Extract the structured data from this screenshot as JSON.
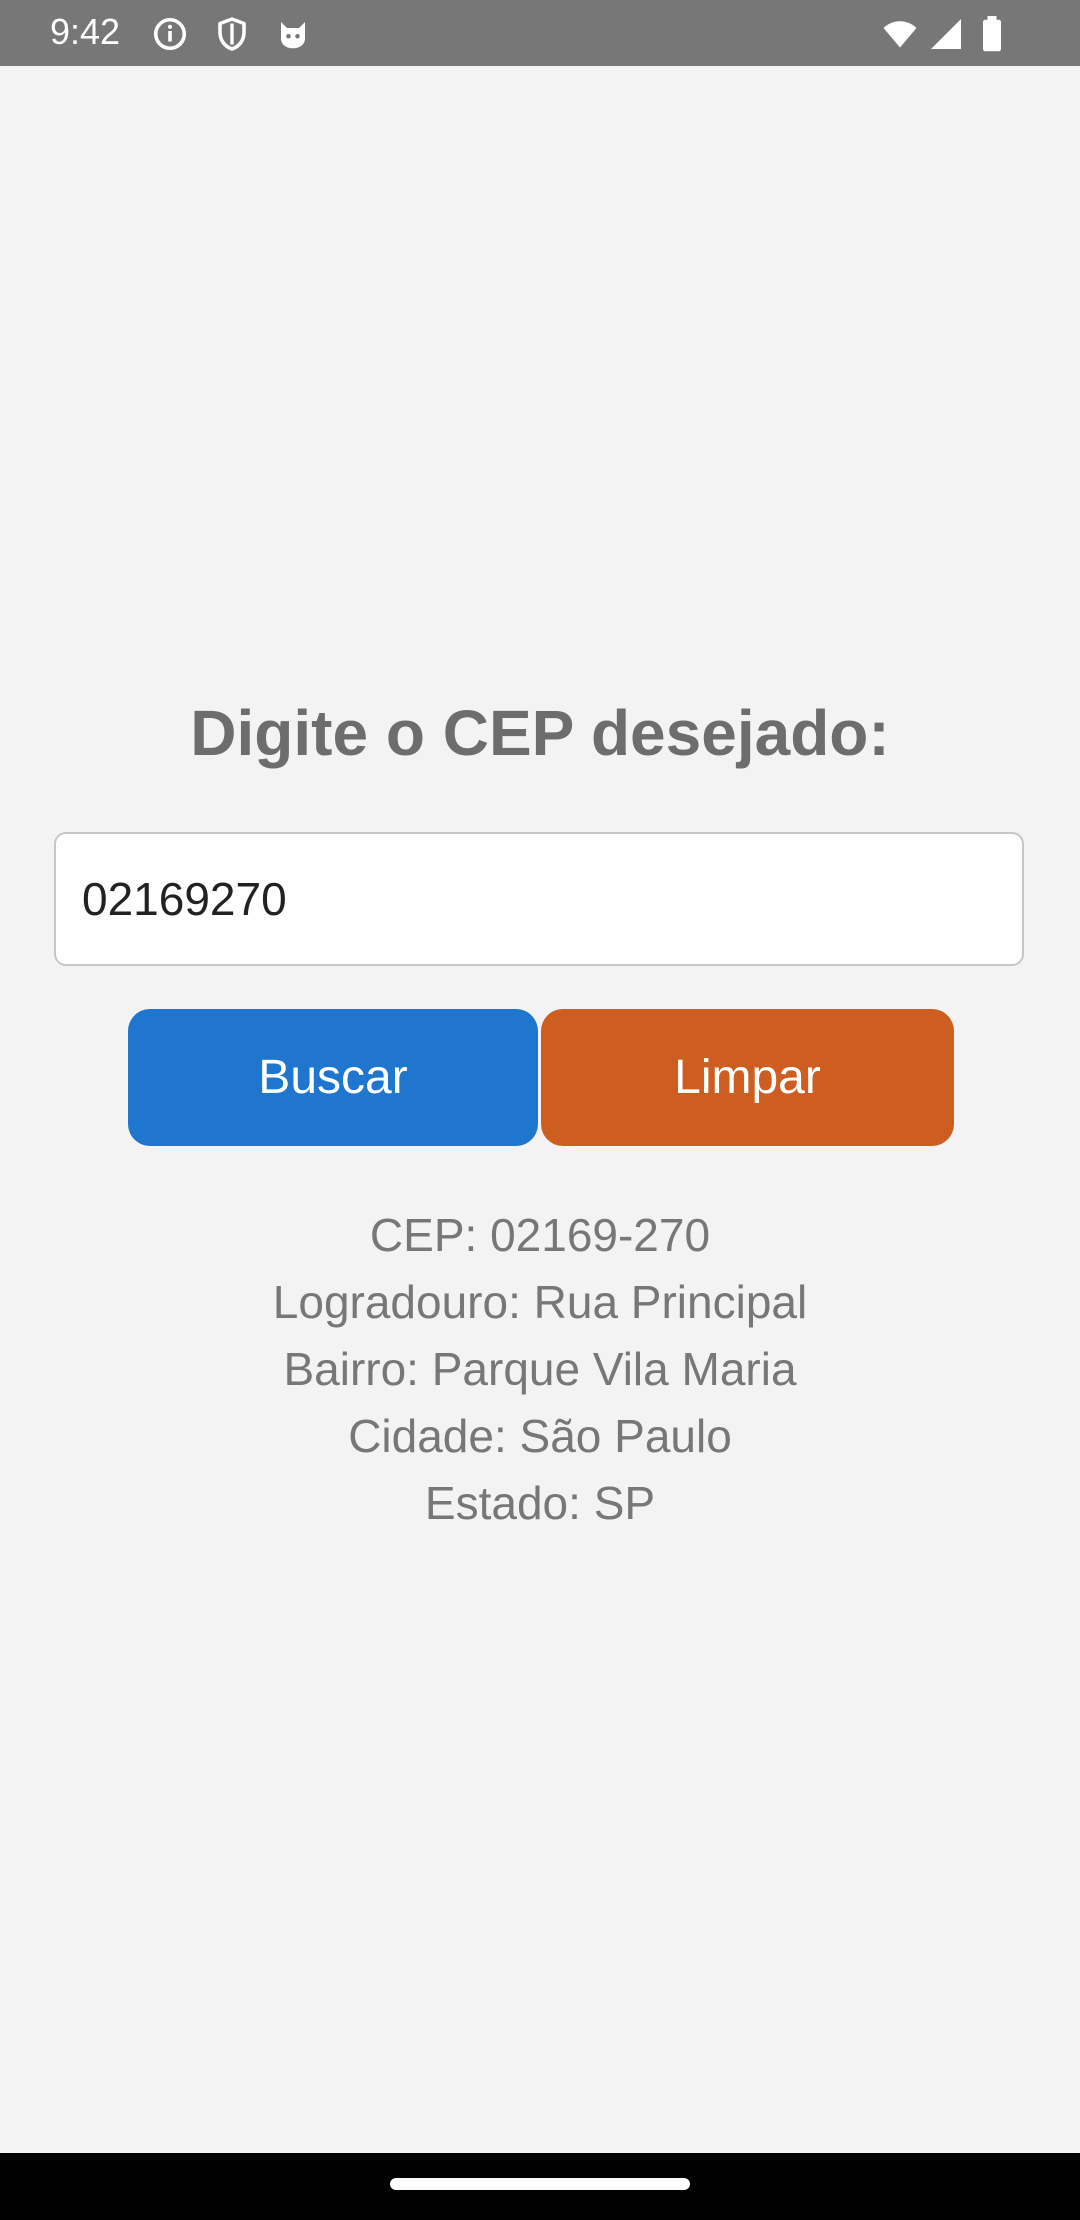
{
  "status_bar": {
    "time": "9:42",
    "left_icons": [
      "info-icon",
      "shield-icon",
      "cat-icon"
    ],
    "right_icons": [
      "wifi-icon",
      "signal-icon",
      "battery-icon"
    ]
  },
  "form": {
    "title": "Digite o CEP desejado:",
    "cep_value": "02169270",
    "search_label": "Buscar",
    "clear_label": "Limpar"
  },
  "result": {
    "cep": "CEP: 02169-270",
    "logradouro": "Logradouro: Rua Principal",
    "bairro": "Bairro: Parque Vila Maria",
    "cidade": "Cidade: São Paulo",
    "estado": "Estado: SP"
  },
  "colors": {
    "background": "#f3f3f3",
    "search_button": "#1e76ce",
    "clear_button": "#ce5e20",
    "status_bar": "#777777"
  }
}
